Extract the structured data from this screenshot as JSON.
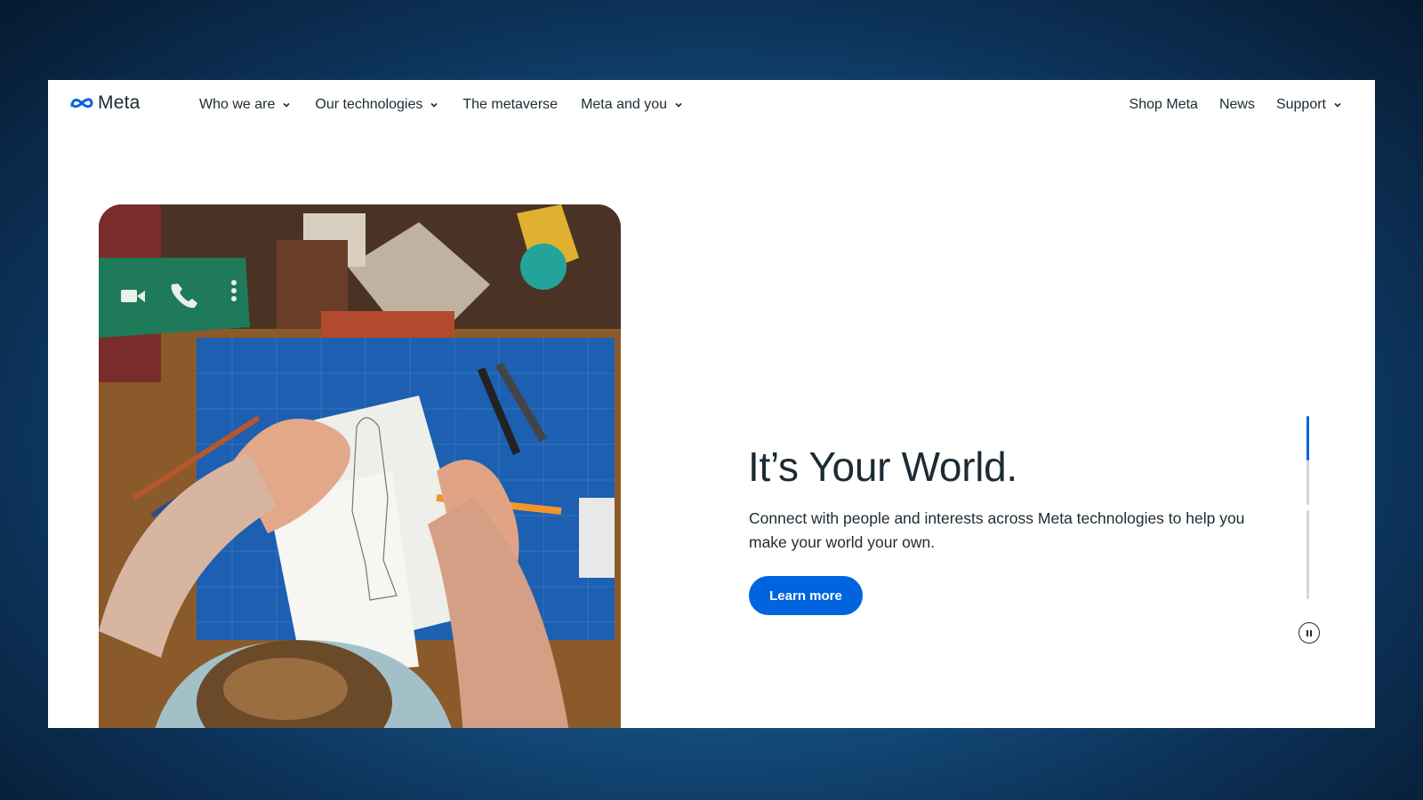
{
  "brand": {
    "name": "Meta",
    "color": "#0064e0"
  },
  "nav": {
    "left": [
      {
        "label": "Who we are",
        "dropdown": true
      },
      {
        "label": "Our technologies",
        "dropdown": true
      },
      {
        "label": "The metaverse",
        "dropdown": false
      },
      {
        "label": "Meta and you",
        "dropdown": true
      }
    ],
    "right": [
      {
        "label": "Shop Meta",
        "dropdown": false
      },
      {
        "label": "News",
        "dropdown": false
      },
      {
        "label": "Support",
        "dropdown": true
      }
    ]
  },
  "hero": {
    "headline": "It’s Your World.",
    "subtext": "Connect with people and interests across Meta technologies to help you make your world your own.",
    "cta_label": "Learn more",
    "image_icons": [
      "video-camera-icon",
      "phone-icon",
      "more-vertical-icon"
    ]
  },
  "carousel": {
    "segments": 3,
    "active_segment": 1,
    "active_fill": 0.5,
    "pause_icon": "pause-icon"
  }
}
